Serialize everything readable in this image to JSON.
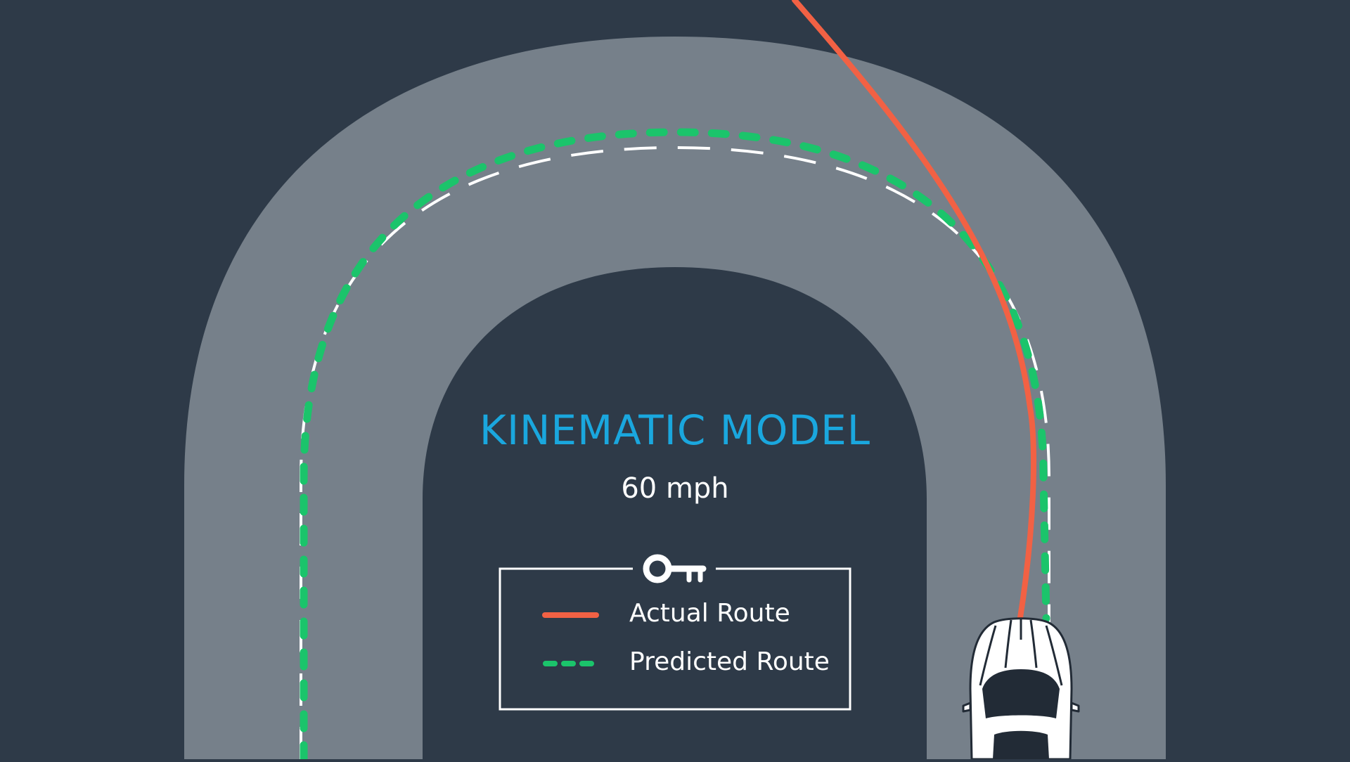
{
  "diagram": {
    "title": "KINEMATIC MODEL",
    "speed": "60 mph",
    "legend": {
      "items": [
        {
          "label": "Actual Route",
          "color": "#f26144",
          "style": "solid"
        },
        {
          "label": "Predicted Route",
          "color": "#1bc46b",
          "style": "dashed"
        }
      ],
      "icon": "key-icon"
    },
    "colors": {
      "background": "#2e3a48",
      "road": "#76808a",
      "lane_marking": "#ffffff",
      "title": "#1aa7de"
    },
    "icons": [
      "key-icon",
      "car-icon"
    ]
  }
}
